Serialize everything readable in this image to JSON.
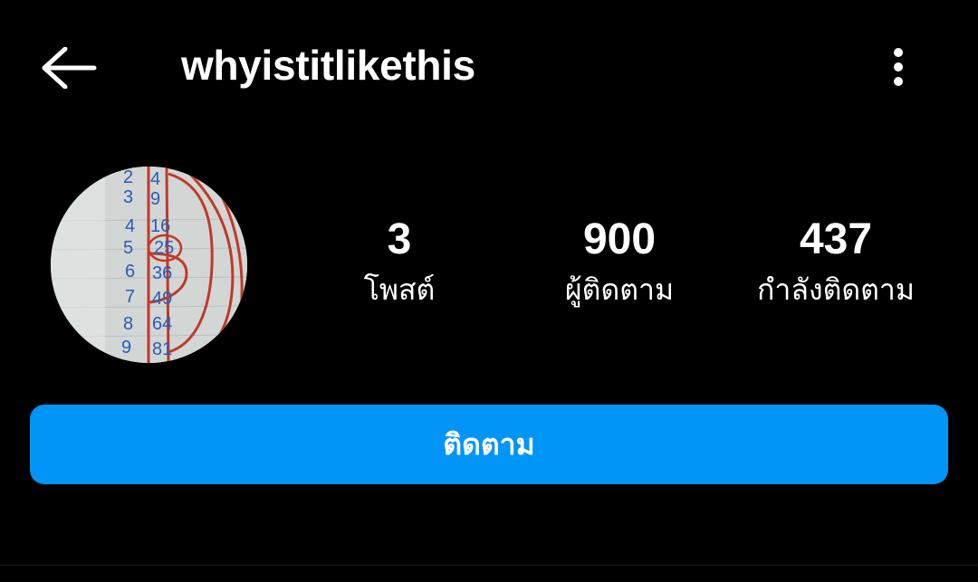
{
  "header": {
    "back_icon": "arrow-left-icon",
    "username": "whyistitlikethis",
    "more_icon": "more-vertical-icon"
  },
  "profile": {
    "avatar": "profile-picture"
  },
  "stats": [
    {
      "value": "3",
      "label": "โพสต์"
    },
    {
      "value": "900",
      "label": "ผู้ติดตาม"
    },
    {
      "value": "437",
      "label": "กำลังติดตาม"
    }
  ],
  "actions": {
    "follow_label": "ติดตาม"
  },
  "colors": {
    "background": "#000000",
    "text": "#ffffff",
    "accent": "#0095f6"
  }
}
